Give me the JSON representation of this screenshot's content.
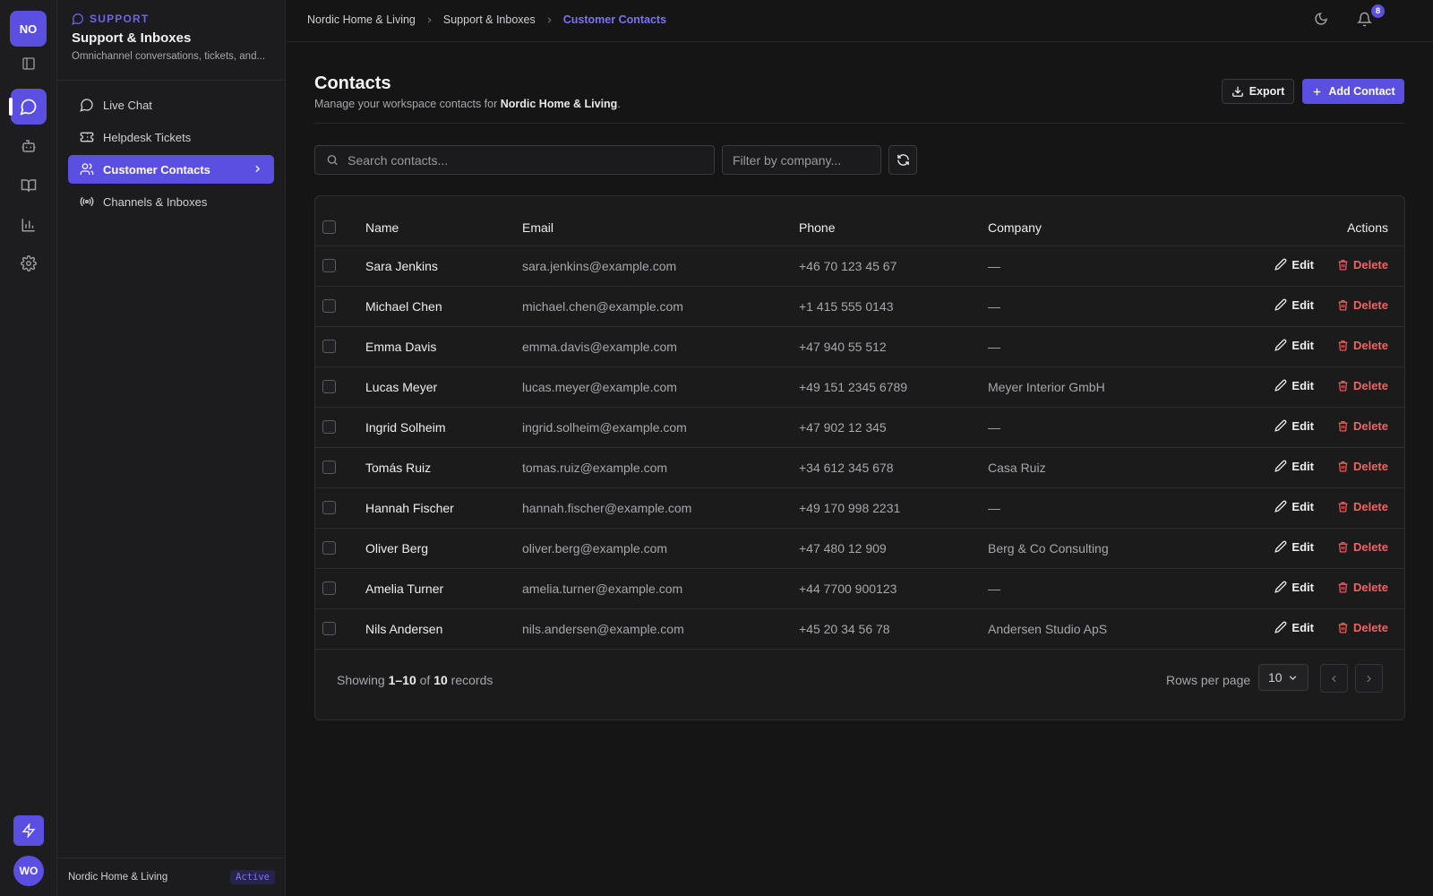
{
  "rail": {
    "workspace_initials": "NO",
    "user_initials": "WO",
    "items": [
      {
        "name": "sidebar-toggle-icon"
      },
      {
        "name": "chat-icon",
        "active": true
      },
      {
        "name": "bot-icon"
      },
      {
        "name": "book-icon"
      },
      {
        "name": "chart-icon"
      },
      {
        "name": "gear-icon"
      }
    ]
  },
  "sidebar": {
    "section": "SUPPORT",
    "title": "Support & Inboxes",
    "description": "Omnichannel conversations, tickets, and...",
    "items": [
      {
        "label": "Live Chat",
        "icon": "message-circle-icon"
      },
      {
        "label": "Helpdesk Tickets",
        "icon": "ticket-icon"
      },
      {
        "label": "Customer Contacts",
        "icon": "users-icon",
        "active": true
      },
      {
        "label": "Channels & Inboxes",
        "icon": "radio-icon"
      }
    ],
    "footer": {
      "workspace": "Nordic Home & Living",
      "status": "Active"
    }
  },
  "topbar": {
    "breadcrumbs": [
      "Nordic Home & Living",
      "Support & Inboxes",
      "Customer Contacts"
    ],
    "notification_count": "8"
  },
  "header": {
    "title": "Contacts",
    "subtitle_prefix": "Manage your workspace contacts for ",
    "subtitle_workspace": "Nordic Home & Living",
    "subtitle_suffix": ".",
    "export_label": "Export",
    "add_label": "Add Contact"
  },
  "filters": {
    "search_placeholder": "Search contacts...",
    "company_placeholder": "Filter by company..."
  },
  "table": {
    "columns": {
      "name": "Name",
      "email": "Email",
      "phone": "Phone",
      "company": "Company",
      "actions": "Actions"
    },
    "edit_label": "Edit",
    "delete_label": "Delete",
    "rows": [
      {
        "name": "Sara Jenkins",
        "email": "sara.jenkins@example.com",
        "phone": "+46 70 123 45 67",
        "company": "—"
      },
      {
        "name": "Michael Chen",
        "email": "michael.chen@example.com",
        "phone": "+1 415 555 0143",
        "company": "—"
      },
      {
        "name": "Emma Davis",
        "email": "emma.davis@example.com",
        "phone": "+47 940 55 512",
        "company": "—"
      },
      {
        "name": "Lucas Meyer",
        "email": "lucas.meyer@example.com",
        "phone": "+49 151 2345 6789",
        "company": "Meyer Interior GmbH"
      },
      {
        "name": "Ingrid Solheim",
        "email": "ingrid.solheim@example.com",
        "phone": "+47 902 12 345",
        "company": "—"
      },
      {
        "name": "Tomás Ruiz",
        "email": "tomas.ruiz@example.com",
        "phone": "+34 612 345 678",
        "company": "Casa Ruiz"
      },
      {
        "name": "Hannah Fischer",
        "email": "hannah.fischer@example.com",
        "phone": "+49 170 998 2231",
        "company": "—"
      },
      {
        "name": "Oliver Berg",
        "email": "oliver.berg@example.com",
        "phone": "+47 480 12 909",
        "company": "Berg & Co Consulting"
      },
      {
        "name": "Amelia Turner",
        "email": "amelia.turner@example.com",
        "phone": "+44 7700 900123",
        "company": "—"
      },
      {
        "name": "Nils Andersen",
        "email": "nils.andersen@example.com",
        "phone": "+45 20 34 56 78",
        "company": "Andersen Studio ApS"
      }
    ]
  },
  "pagination": {
    "showing_prefix": "Showing ",
    "range": "1–10",
    "of": " of ",
    "total": "10",
    "suffix": " records",
    "rows_per_page_label": "Rows per page",
    "rows_per_page_value": "10"
  },
  "colors": {
    "accent": "#5a4fe0",
    "danger": "#f06464",
    "background": "#151515"
  }
}
